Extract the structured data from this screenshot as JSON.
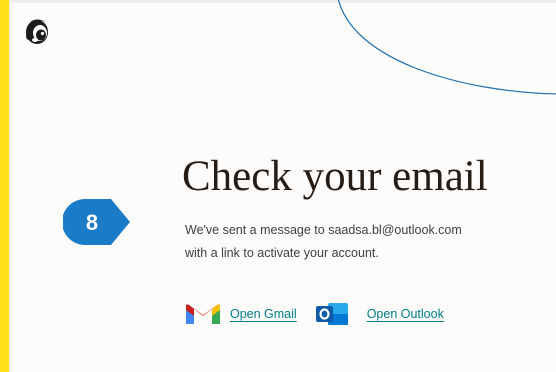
{
  "heading": "Check your email",
  "message": {
    "line1": "We've sent a message to saadsa.bl@outlook.com",
    "line2": "with a link to activate your account."
  },
  "step_marker": {
    "number": "8",
    "color": "#1a7bc9"
  },
  "links": {
    "gmail": "Open Gmail",
    "outlook": "Open Outlook"
  },
  "icons": {
    "logo": "mailchimp-freddie-icon",
    "gmail": "gmail-icon",
    "outlook": "outlook-icon"
  },
  "colors": {
    "brand_yellow": "#ffe01b",
    "link": "#007c89",
    "heading": "#241c15",
    "annotation_line": "#1d6fae"
  }
}
